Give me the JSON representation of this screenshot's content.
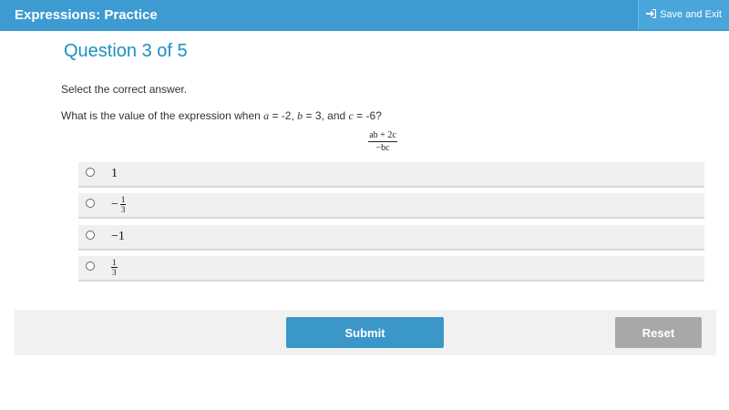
{
  "header": {
    "title": "Expressions: Practice",
    "save_exit_label": "Save and Exit",
    "save_exit_icon": "sign-in-arrow-icon"
  },
  "question": {
    "title": "Question 3 of 5",
    "instruction": "Select the correct answer.",
    "prompt_prefix": "What is the value of the expression when ",
    "var_a": "a",
    "val_a": " = -2, ",
    "var_b": "b",
    "val_b": " = 3, and ",
    "var_c": "c",
    "val_c": " = -6?",
    "expression": {
      "numerator": "ab + 2c",
      "denominator": "−bc"
    }
  },
  "options": [
    {
      "sign": "",
      "whole": "1",
      "frac_num": "",
      "frac_den": ""
    },
    {
      "sign": "−",
      "whole": "",
      "frac_num": "1",
      "frac_den": "3"
    },
    {
      "sign": "",
      "whole": "−1",
      "frac_num": "",
      "frac_den": ""
    },
    {
      "sign": "",
      "whole": "",
      "frac_num": "1",
      "frac_den": "3"
    }
  ],
  "footer": {
    "submit_label": "Submit",
    "reset_label": "Reset"
  },
  "colors": {
    "header_bg": "#3d9bd1",
    "title_blue": "#1d8fc4",
    "submit_bg": "#3c97c9",
    "reset_bg": "#a8a8a8"
  }
}
